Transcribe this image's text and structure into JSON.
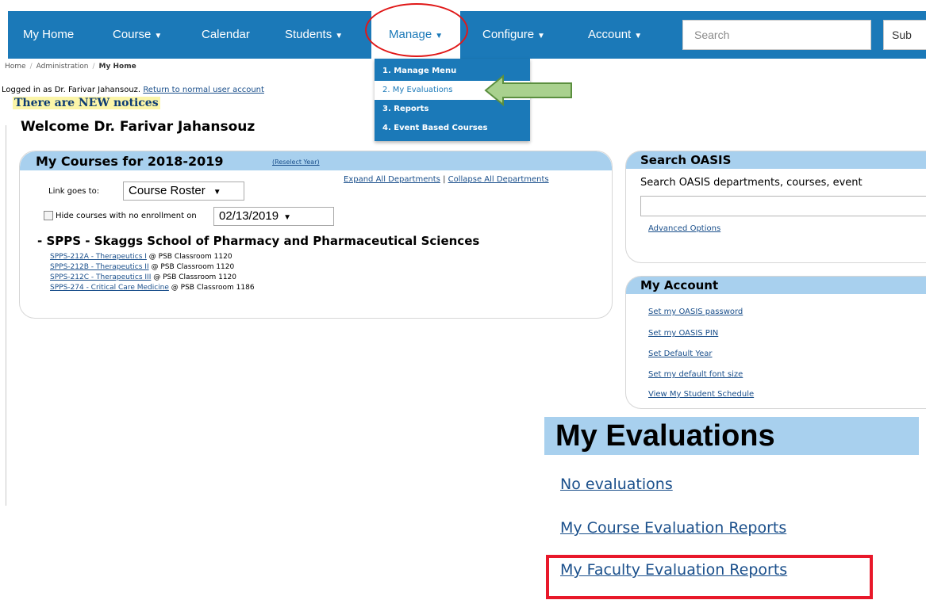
{
  "nav": {
    "items": [
      {
        "label": "My Home",
        "caret": false
      },
      {
        "label": "Course",
        "caret": true
      },
      {
        "label": "Calendar",
        "caret": false
      },
      {
        "label": "Students",
        "caret": true
      },
      {
        "label": "Manage",
        "caret": true
      },
      {
        "label": "Configure",
        "caret": true
      },
      {
        "label": "Account",
        "caret": true
      }
    ],
    "search_placeholder": "Search",
    "submit_label": "Sub"
  },
  "breadcrumb": [
    "Home",
    "Administration",
    "My Home"
  ],
  "manage_menu": [
    "1. Manage Menu",
    "2. My Evaluations",
    "3. Reports",
    "4. Event Based Courses"
  ],
  "login": {
    "text": "Logged in as Dr. Farivar Jahansouz.",
    "return_link": "Return to normal user account",
    "notices": "There are NEW notices",
    "welcome": "Welcome Dr. Farivar Jahansouz"
  },
  "courses": {
    "title": "My Courses for 2018-2019",
    "reselect": "(Reselect Year)",
    "expand": "Expand All Departments",
    "separator": "|",
    "collapse": "Collapse All Departments",
    "link_goes_label": "Link goes to:",
    "link_goes_value": "Course Roster",
    "hide_label": "Hide courses with no enrollment on",
    "hide_date": "02/13/2019",
    "department": "- SPPS - Skaggs School of Pharmacy and Pharmaceutical Sciences",
    "rows": [
      {
        "course": "SPPS-212A - Therapeutics I",
        "location": "@ PSB Classroom 1120"
      },
      {
        "course": "SPPS-212B - Therapeutics II",
        "location": "@ PSB Classroom 1120"
      },
      {
        "course": "SPPS-212C - Therapeutics III",
        "location": "@ PSB Classroom 1120"
      },
      {
        "course": "SPPS-274 - Critical Care Medicine",
        "location": "@ PSB Classroom 1186"
      }
    ]
  },
  "search_oasis": {
    "title": "Search OASIS",
    "description": "Search OASIS departments, courses, event",
    "advanced": "Advanced Options"
  },
  "account": {
    "title": "My Account",
    "links": [
      "Set my OASIS password",
      "Set my OASIS PIN",
      "Set Default Year",
      "Set my default font size",
      "View My Student Schedule"
    ]
  },
  "evaluations": {
    "title": "My Evaluations",
    "links": [
      "No evaluations",
      "My Course Evaluation Reports",
      "My Faculty Evaluation Reports"
    ]
  },
  "colors": {
    "nav_blue": "#1b79b8",
    "panel_header": "#a8d0ee",
    "highlight_red": "#e8182a",
    "arrow_green": "#a9d18e"
  }
}
